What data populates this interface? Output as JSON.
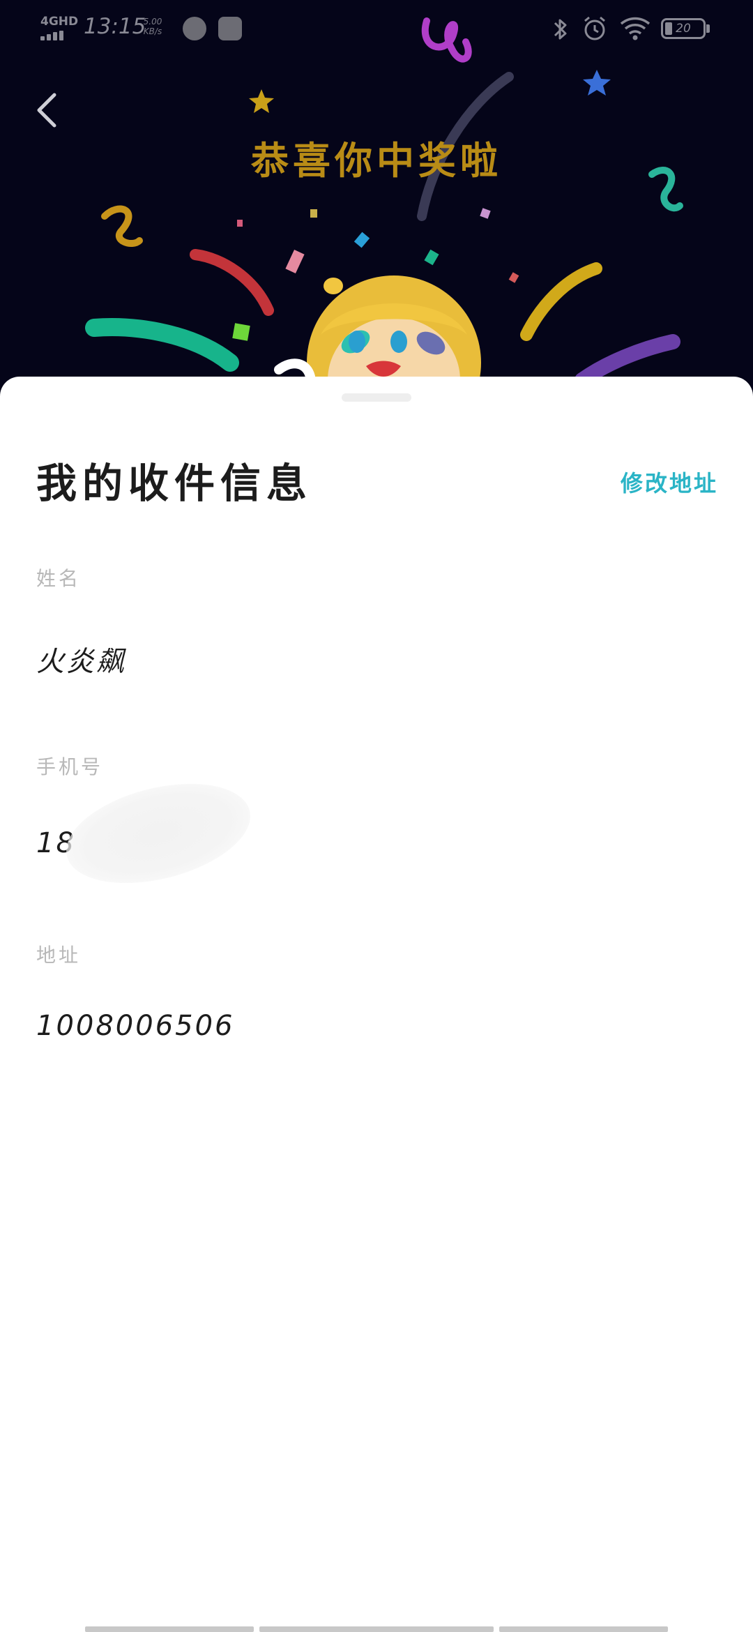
{
  "status_bar": {
    "network": "4GHD",
    "time": "13:15",
    "speed_value": "5.00",
    "speed_unit": "KB/s",
    "battery_level": "20",
    "icons": [
      "signal-icon",
      "speedometer-app-icon",
      "video-app-icon",
      "bluetooth-icon",
      "alarm-icon",
      "wifi-icon",
      "battery-icon"
    ]
  },
  "banner": {
    "title": "恭喜你中奖啦",
    "back_icon": "chevron-left-icon",
    "colors": {
      "background": "#050519",
      "title": "#b98c16"
    }
  },
  "sheet": {
    "title": "我的收件信息",
    "edit_button": "修改地址",
    "accent_color": "#2ab4c6",
    "fields": [
      {
        "label": "姓名",
        "value": "火炎飙"
      },
      {
        "label": "手机号",
        "value": "18"
      },
      {
        "label": "地址",
        "value": "1008006506"
      }
    ]
  }
}
